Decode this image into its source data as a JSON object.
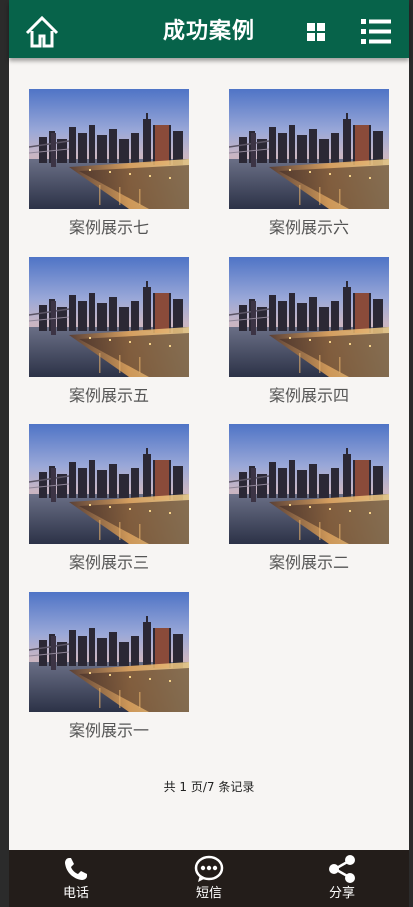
{
  "header": {
    "title": "成功案例",
    "home_icon": "home-icon",
    "grid_icon": "grid-icon",
    "menu_icon": "list-icon",
    "bg": "#07634a"
  },
  "cases": [
    {
      "label": "案例展示七"
    },
    {
      "label": "案例展示六"
    },
    {
      "label": "案例展示五"
    },
    {
      "label": "案例展示四"
    },
    {
      "label": "案例展示三"
    },
    {
      "label": "案例展示二"
    },
    {
      "label": "案例展示一"
    }
  ],
  "pager": {
    "text": "共 1 页/7 条记录"
  },
  "footer": {
    "items": [
      {
        "label": "电话",
        "icon": "phone-icon"
      },
      {
        "label": "短信",
        "icon": "sms-icon"
      },
      {
        "label": "分享",
        "icon": "share-icon"
      }
    ],
    "bg": "#231d1a"
  }
}
